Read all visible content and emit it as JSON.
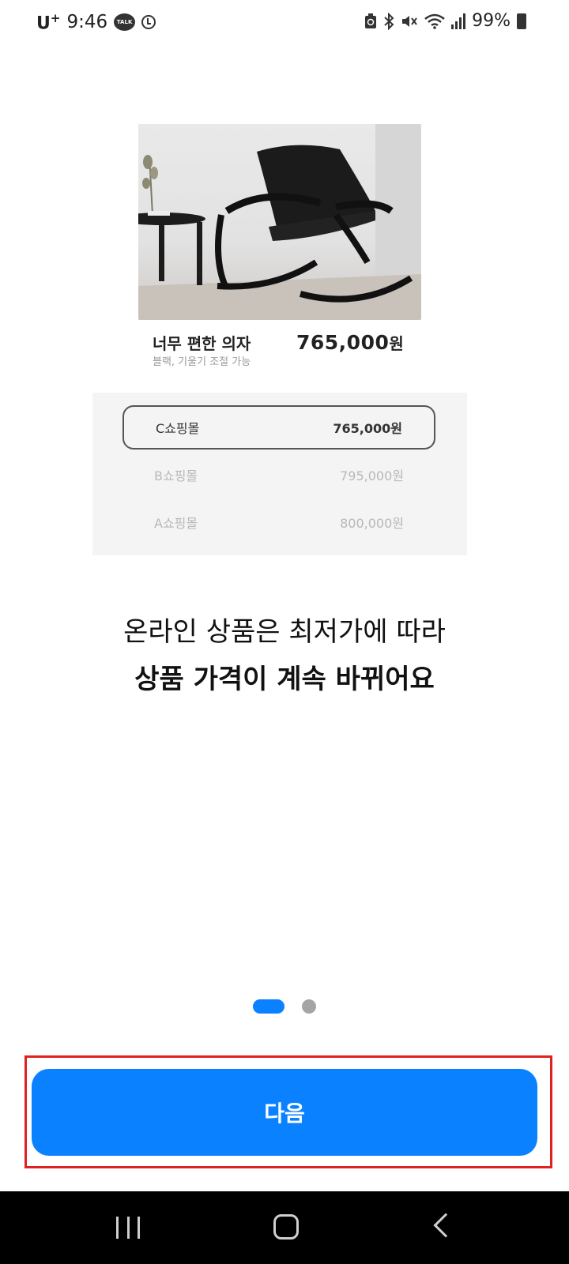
{
  "status_bar": {
    "carrier": "U",
    "carrier_plus": "+",
    "time": "9:46",
    "talk_badge": "TALK",
    "battery": "99%",
    "icons": [
      "kakaotalk-icon",
      "alarm-icon",
      "recycle-icon",
      "bluetooth-icon",
      "mute-icon",
      "wifi-icon",
      "signal-icon",
      "battery-charging-icon"
    ]
  },
  "illustration": {
    "product_name": "너무 편한 의자",
    "product_desc": "블랙, 기울기 조절 가능",
    "product_price": "765,000",
    "product_price_unit": "원",
    "malls": [
      {
        "name": "C쇼핑몰",
        "price": "765,000원",
        "selected": true
      },
      {
        "name": "B쇼핑몰",
        "price": "795,000원",
        "selected": false
      },
      {
        "name": "A쇼핑몰",
        "price": "800,000원",
        "selected": false
      }
    ]
  },
  "message": {
    "line1": "온라인 상품은 최저가에 따라",
    "line2": "상품 가격이 계속 바뀌어요"
  },
  "pager": {
    "current_page": 1,
    "total_pages": 2
  },
  "next_button": {
    "label": "다음",
    "color": "#0a82ff"
  },
  "highlight_color": "#e12121",
  "nav_bar": {
    "icons": [
      "recent-apps-icon",
      "home-icon",
      "back-icon"
    ]
  }
}
